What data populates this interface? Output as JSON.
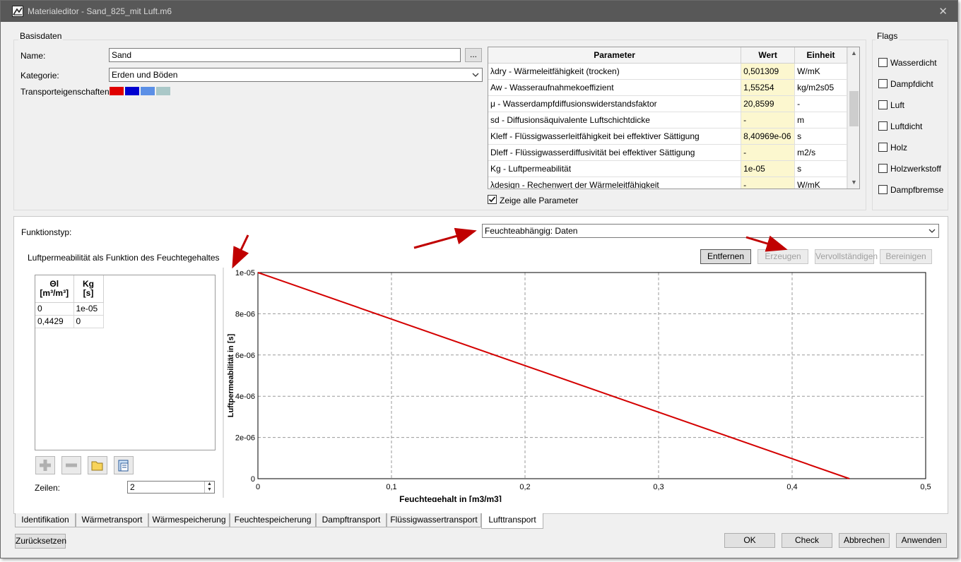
{
  "window": {
    "title": "Materialeditor - Sand_825_mit Luft.m6",
    "close_glyph": "✕"
  },
  "basis": {
    "group_title": "Basisdaten",
    "name_label": "Name:",
    "name_value": "Sand",
    "browse_label": "...",
    "kategorie_label": "Kategorie:",
    "kategorie_value": "Erden und Böden",
    "transport_label": "Transporteigenschaften:",
    "swatch_colors": [
      "#e00000",
      "#0000d0",
      "#5b8fe6",
      "#aac8c8"
    ]
  },
  "params": {
    "headers": [
      "Parameter",
      "Wert",
      "Einheit"
    ],
    "rows": [
      {
        "name": "λdry - Wärmeleitfähigkeit (trocken)",
        "value": "0,501309",
        "unit": "W/mK"
      },
      {
        "name": "Aw - Wasseraufnahmekoeffizient",
        "value": "1,55254",
        "unit": "kg/m2s05"
      },
      {
        "name": "μ - Wasserdampfdiffusionswiderstandsfaktor",
        "value": "20,8599",
        "unit": "-"
      },
      {
        "name": "sd - Diffusionsäquivalente Luftschichtdicke",
        "value": "-",
        "unit": "m"
      },
      {
        "name": "Kleff - Flüssigwasserleitfähigkeit bei effektiver Sättigung",
        "value": "8,40969e-06",
        "unit": "s"
      },
      {
        "name": "Dleff - Flüssigwasserdiffusivität bei effektiver Sättigung",
        "value": "-",
        "unit": "m2/s"
      },
      {
        "name": "Kg - Luftpermeabilität",
        "value": "1e-05",
        "unit": "s"
      },
      {
        "name": "λdesign - Rechenwert der Wärmeleitfähigkeit",
        "value": "-",
        "unit": "W/mK"
      }
    ],
    "show_all_label": "Zeige alle Parameter",
    "scroll_up": "▲",
    "scroll_down": "▼"
  },
  "flags": {
    "group_title": "Flags",
    "items": [
      "Wasserdicht",
      "Dampfdicht",
      "Luft",
      "Luftdicht",
      "Holz",
      "Holzwerkstoff",
      "Dampfbremse"
    ]
  },
  "function": {
    "type_label": "Funktionstyp:",
    "type_value": "Feuchteabhängig: Daten",
    "subtitle": "Luftpermeabilität als Funktion des Feuchtegehaltes",
    "buttons": {
      "remove": "Entfernen",
      "create": "Erzeugen",
      "complete": "Vervollständigen",
      "clean": "Bereinigen"
    },
    "table": {
      "col1_line1": "Θl",
      "col1_line2": "[m³/m³]",
      "col2_line1": "Kg",
      "col2_line2": "[s]",
      "rows": [
        [
          "0",
          "1e-05"
        ],
        [
          "0,4429",
          "0"
        ]
      ]
    },
    "rows_label": "Zeilen:",
    "rows_value": "2",
    "spin_up": "▲",
    "spin_down": "▼"
  },
  "chart_data": {
    "type": "line",
    "title": "",
    "xlabel": "Feuchtegehalt in [m3/m3]",
    "ylabel": "Luftpermeabilität in [s]",
    "xlim": [
      0,
      0.5
    ],
    "ylim": [
      0,
      1e-05
    ],
    "x_ticks": [
      "0",
      "0,1",
      "0,2",
      "0,3",
      "0,4",
      "0,5"
    ],
    "y_ticks": [
      "0",
      "2e-06",
      "4e-06",
      "6e-06",
      "8e-06",
      "1e-05"
    ],
    "grid": true,
    "series": [
      {
        "x": [
          0,
          0.4429
        ],
        "y": [
          1e-05,
          0
        ],
        "color": "#d40000"
      }
    ]
  },
  "tabs": {
    "items": [
      "Identifikation",
      "Wärmetransport",
      "Wärmespeicherung",
      "Feuchtespeicherung",
      "Dampftransport",
      "Flüssigwassertransport",
      "Lufttransport"
    ],
    "active": "Lufttransport"
  },
  "footer": {
    "reset": "Zurücksetzen",
    "ok": "OK",
    "check": "Check",
    "cancel": "Abbrechen",
    "apply": "Anwenden"
  },
  "colors": {
    "accent_line": "#d40000",
    "annotation_arrow": "#c00000",
    "value_cell": "#fcf7cf"
  }
}
